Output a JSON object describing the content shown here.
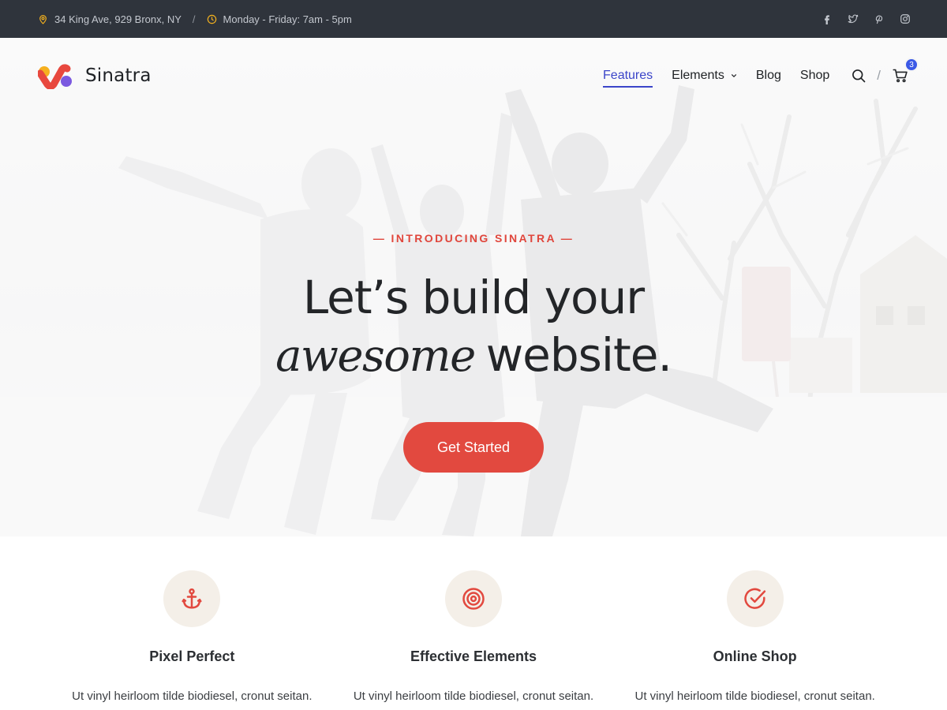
{
  "topbar": {
    "address": "34 King Ave, 929 Bronx, NY",
    "separator": "/",
    "hours": "Monday - Friday: 7am - 5pm",
    "icons": {
      "address": "map-pin-icon",
      "hours": "clock-icon",
      "social": [
        "facebook-icon",
        "twitter-icon",
        "pinterest-icon",
        "instagram-icon"
      ]
    }
  },
  "header": {
    "logo_text": "Sinatra",
    "nav": [
      {
        "label": "Features",
        "active": true
      },
      {
        "label": "Elements",
        "has_dropdown": true
      },
      {
        "label": "Blog"
      },
      {
        "label": "Shop"
      }
    ],
    "tools_separator": "/",
    "cart_count": "3"
  },
  "hero": {
    "eyebrow": "— INTRODUCING SINATRA —",
    "headline_line1": "Let’s build your",
    "headline_italic": "awesome",
    "headline_line2_rest": "website.",
    "cta_label": "Get Started"
  },
  "features": [
    {
      "icon": "anchor-icon",
      "title": "Pixel Perfect",
      "description": "Ut vinyl heirloom tilde biodiesel, cronut seitan."
    },
    {
      "icon": "target-icon",
      "title": "Effective Elements",
      "description": "Ut vinyl heirloom tilde biodiesel, cronut seitan."
    },
    {
      "icon": "check-circle-icon",
      "title": "Online Shop",
      "description": "Ut vinyl heirloom tilde biodiesel, cronut seitan."
    }
  ],
  "colors": {
    "accent": "#e2493f",
    "nav_active": "#3b45c9",
    "topbar_bg": "#2f343c",
    "icon_yellow": "#f2b01e",
    "feature_icon_bg": "#f4efe8",
    "badge": "#3b59e6"
  }
}
